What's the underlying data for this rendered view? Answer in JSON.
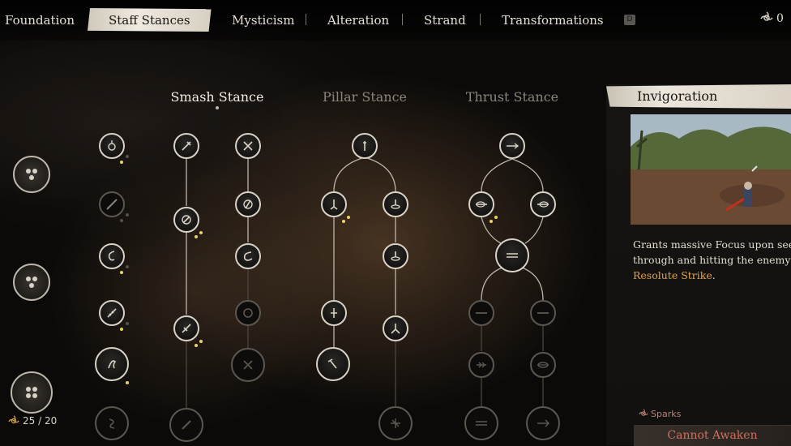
{
  "tabs": [
    {
      "label": "Foundation",
      "active": false
    },
    {
      "label": "Staff Stances",
      "active": true
    },
    {
      "label": "Mysticism",
      "active": false
    },
    {
      "label": "Alteration",
      "active": false
    },
    {
      "label": "Strand",
      "active": false
    },
    {
      "label": "Transformations",
      "active": false
    }
  ],
  "key_hint": "D",
  "sparks_count": "0",
  "columns": {
    "smash": "Smash Stance",
    "pillar": "Pillar Stance",
    "thrust": "Thrust Stance"
  },
  "skill_points": "25 / 20",
  "panel": {
    "title": "Invigoration",
    "desc_line1": "Grants massive Focus upon seeing",
    "desc_line2": "through and hitting the enemy wi",
    "desc_highlight": "Resolute Strike",
    "desc_end": ".",
    "sparks_label": "Sparks",
    "button_label": "Cannot Awaken"
  },
  "colors": {
    "accent_gold": "#e0a44a",
    "pip_yellow": "#e8d36a",
    "button_red": "#cf6f5e"
  }
}
